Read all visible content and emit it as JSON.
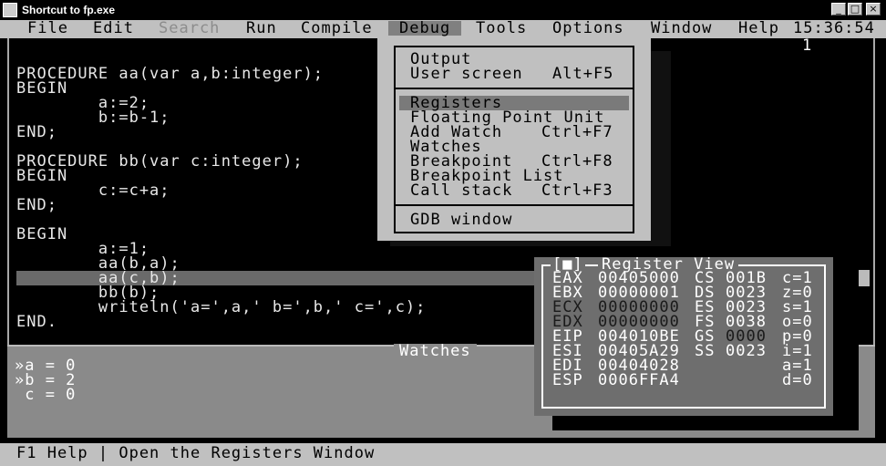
{
  "window": {
    "title": "Shortcut to fp.exe"
  },
  "menubar": {
    "items": [
      "File",
      "Edit",
      "Search",
      "Run",
      "Compile",
      "Debug",
      "Tools",
      "Options",
      "Window",
      "Help"
    ],
    "clock": "15:36:54",
    "window_number": "1"
  },
  "editor": {
    "lines": [
      "PROCEDURE aa(var a,b:integer);",
      "BEGIN",
      "        a:=2;",
      "        b:=b-1;",
      "END;",
      "",
      "PROCEDURE bb(var c:integer);",
      "BEGIN",
      "        c:=c+a;",
      "END;",
      "",
      "BEGIN",
      "        a:=1;",
      "        aa(b,a);",
      "        aa(c,b);",
      "        bb(b);",
      "        writeln('a=',a,' b=',b,' c=',c);",
      "END."
    ]
  },
  "debug_menu": {
    "group1": [
      {
        "label": "Output",
        "shortcut": ""
      },
      {
        "label": "User screen",
        "shortcut": "Alt+F5"
      }
    ],
    "group2": [
      {
        "label": "Registers",
        "shortcut": ""
      },
      {
        "label": "Floating Point Unit",
        "shortcut": ""
      },
      {
        "label": "Add Watch",
        "shortcut": "Ctrl+F7"
      },
      {
        "label": "Watches",
        "shortcut": ""
      },
      {
        "label": "Breakpoint",
        "shortcut": "Ctrl+F8"
      },
      {
        "label": "Breakpoint List",
        "shortcut": ""
      },
      {
        "label": "Call stack",
        "shortcut": "Ctrl+F3"
      }
    ],
    "group3": [
      {
        "label": "GDB window",
        "shortcut": ""
      }
    ]
  },
  "register_view": {
    "title": "Register View",
    "close_glyph": "[■]",
    "rows": [
      {
        "r1": "EAX",
        "v1": "00405000",
        "r2": "CS",
        "v2": "001B",
        "f": "c=1"
      },
      {
        "r1": "EBX",
        "v1": "00000001",
        "r2": "DS",
        "v2": "0023",
        "f": "z=0"
      },
      {
        "r1": "ECX",
        "v1": "00000000",
        "r2": "ES",
        "v2": "0023",
        "f": "s=1"
      },
      {
        "r1": "EDX",
        "v1": "00000000",
        "r2": "FS",
        "v2": "0038",
        "f": "o=0"
      },
      {
        "r1": "EIP",
        "v1": "004010BE",
        "r2": "GS",
        "v2": "0000",
        "f": "p=0"
      },
      {
        "r1": "ESI",
        "v1": "00405A29",
        "r2": "SS",
        "v2": "0023",
        "f": "i=1"
      },
      {
        "r1": "EDI",
        "v1": "00404028",
        "r2": "",
        "v2": "",
        "f": "a=1"
      },
      {
        "r1": "ESP",
        "v1": "0006FFA4",
        "r2": "",
        "v2": "",
        "f": "d=0"
      }
    ]
  },
  "watches": {
    "title": "Watches",
    "items": [
      "»a = 0",
      "»b = 2",
      " c = 0"
    ]
  },
  "statusbar": {
    "text": "F1 Help | Open the Registers Window"
  }
}
